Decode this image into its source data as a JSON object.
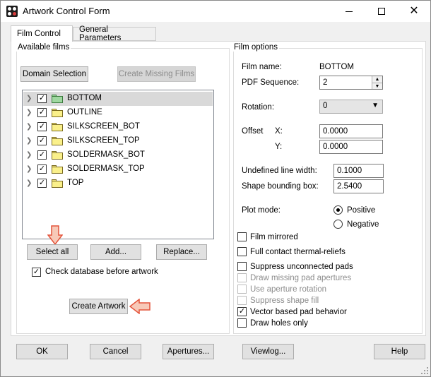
{
  "window": {
    "title": "Artwork Control Form",
    "minimize_icon": "minimize-icon",
    "maximize_icon": "maximize-icon",
    "close_icon": "close-icon",
    "close_glyph": "✕"
  },
  "tabs": [
    {
      "label": "Film Control",
      "active": true
    },
    {
      "label": "General Parameters",
      "active": false
    }
  ],
  "available_films": {
    "title": "Available films",
    "domain_selection_label": "Domain Selection",
    "create_missing_label": "Create Missing Films",
    "items": [
      {
        "name": "BOTTOM",
        "checked": true,
        "selected": true,
        "folder_color": "#9fd8a0"
      },
      {
        "name": "OUTLINE",
        "checked": true,
        "selected": false,
        "folder_color": "#faf08a"
      },
      {
        "name": "SILKSCREEN_BOT",
        "checked": true,
        "selected": false,
        "folder_color": "#faf08a"
      },
      {
        "name": "SILKSCREEN_TOP",
        "checked": true,
        "selected": false,
        "folder_color": "#faf08a"
      },
      {
        "name": "SOLDERMASK_BOT",
        "checked": true,
        "selected": false,
        "folder_color": "#faf08a"
      },
      {
        "name": "SOLDERMASK_TOP",
        "checked": true,
        "selected": false,
        "folder_color": "#faf08a"
      },
      {
        "name": "TOP",
        "checked": true,
        "selected": false,
        "folder_color": "#faf08a"
      }
    ],
    "expander_glyph": "❯",
    "check_glyph": "✓",
    "select_all_label": "Select all",
    "add_label": "Add...",
    "replace_label": "Replace...",
    "check_db_label": "Check database before artwork",
    "check_db_checked": true,
    "create_artwork_label": "Create Artwork"
  },
  "film_options": {
    "title": "Film options",
    "film_name_label": "Film name:",
    "film_name_value": "BOTTOM",
    "pdf_sequence_label": "PDF Sequence:",
    "pdf_sequence_value": "2",
    "rotation_label": "Rotation:",
    "rotation_value": "0",
    "offset_label": "Offset",
    "offset_x_label": "X:",
    "offset_x_value": "0.0000",
    "offset_y_label": "Y:",
    "offset_y_value": "0.0000",
    "undefined_line_width_label": "Undefined line width:",
    "undefined_line_width_value": "0.1000",
    "shape_bounding_box_label": "Shape bounding box:",
    "shape_bounding_box_value": "2.5400",
    "plot_mode_label": "Plot mode:",
    "positive_label": "Positive",
    "negative_label": "Negative",
    "plot_mode_selected": "Positive",
    "checkboxes": [
      {
        "label": "Film mirrored",
        "checked": false,
        "enabled": true
      },
      {
        "label": "Full contact thermal-reliefs",
        "checked": false,
        "enabled": true
      },
      {
        "label": "Suppress unconnected pads",
        "checked": false,
        "enabled": true
      },
      {
        "label": "Draw missing pad apertures",
        "checked": false,
        "enabled": false
      },
      {
        "label": "Use aperture rotation",
        "checked": false,
        "enabled": false
      },
      {
        "label": "Suppress shape fill",
        "checked": false,
        "enabled": false
      },
      {
        "label": "Vector based pad behavior",
        "checked": true,
        "enabled": true
      },
      {
        "label": "Draw holes only",
        "checked": false,
        "enabled": true
      }
    ]
  },
  "footer": {
    "ok_label": "OK",
    "cancel_label": "Cancel",
    "apertures_label": "Apertures...",
    "viewlog_label": "Viewlog...",
    "help_label": "Help"
  },
  "colors": {
    "annotation_arrow_fill": "#f7c9b8",
    "annotation_arrow_stroke": "#e4533a"
  }
}
